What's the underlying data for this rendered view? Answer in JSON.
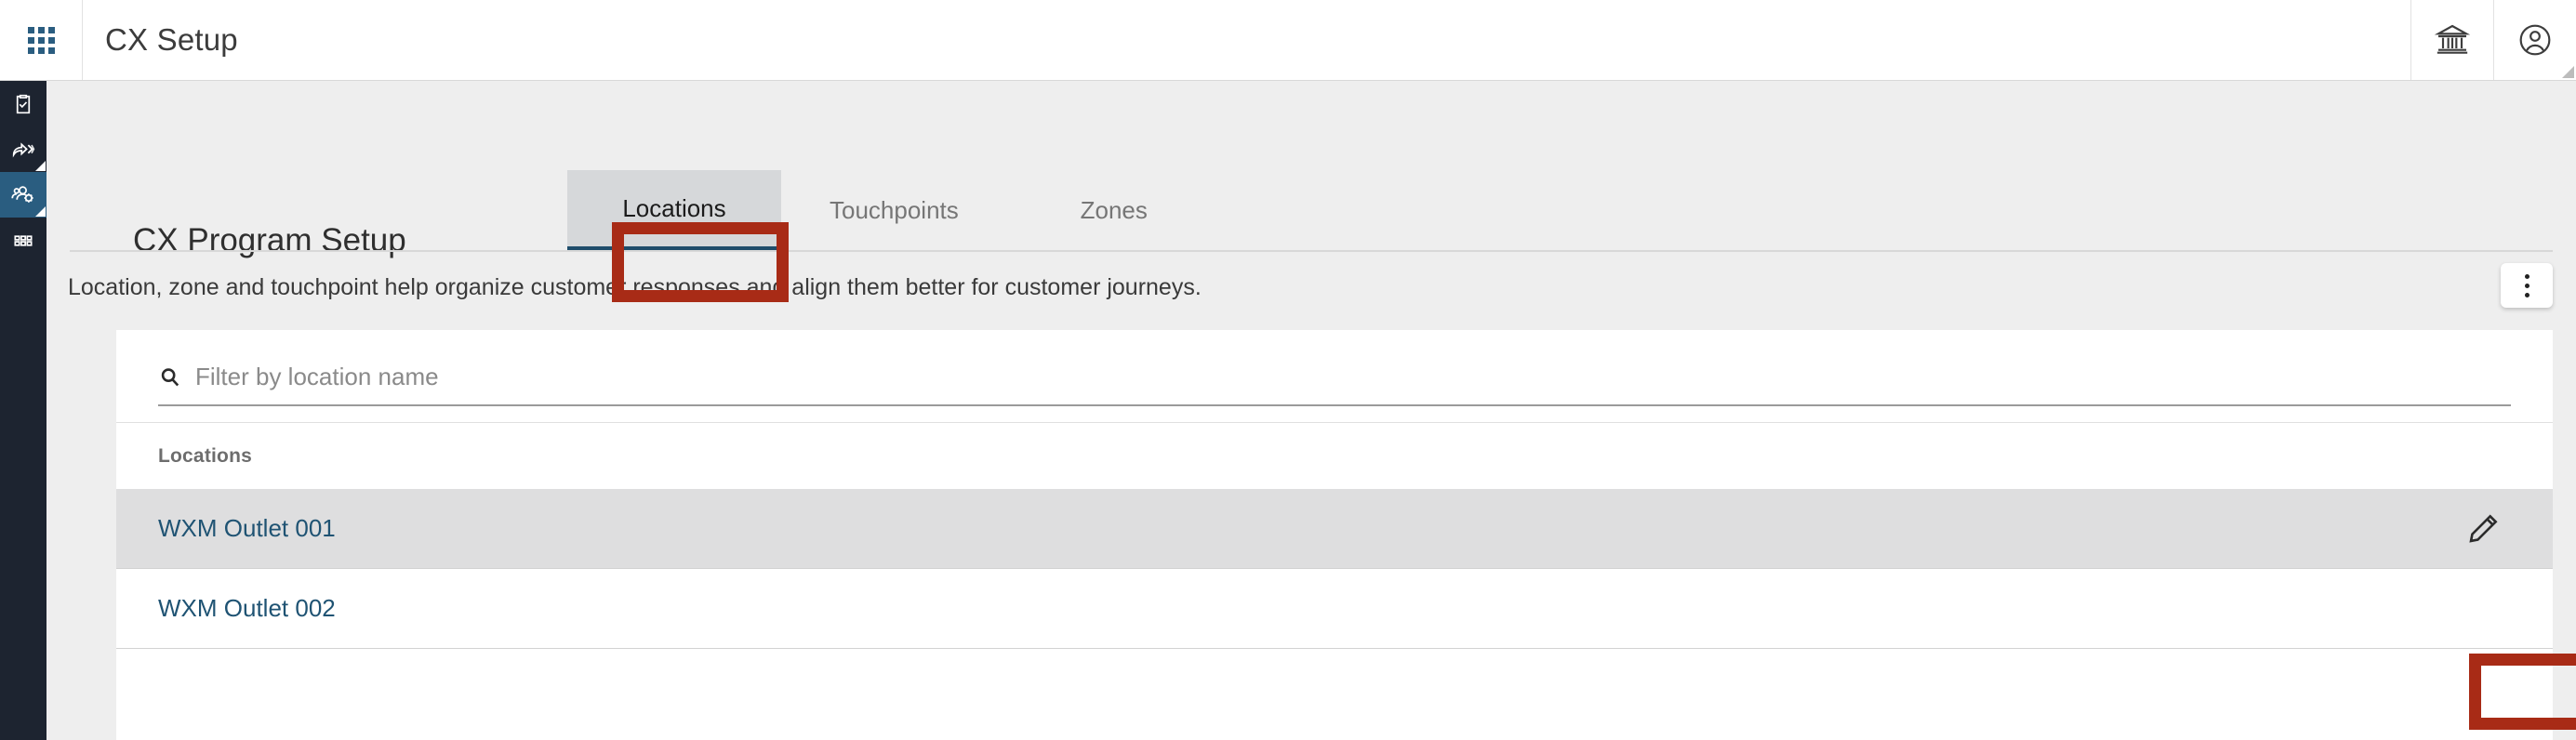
{
  "topbar": {
    "apps_icon": "apps-grid-icon",
    "title": "CX Setup",
    "actions": [
      {
        "icon": "bank-icon",
        "name": "institution-button"
      },
      {
        "icon": "user-circle-icon",
        "name": "account-button"
      }
    ]
  },
  "sidebar": {
    "items": [
      {
        "icon": "clipboard-check-icon",
        "name": "sidebar-item-surveys",
        "active": false,
        "corner": false
      },
      {
        "icon": "share-arrow-icon",
        "name": "sidebar-item-distribution",
        "active": false,
        "corner": true
      },
      {
        "icon": "people-gear-icon",
        "name": "sidebar-item-cx-setup",
        "active": true,
        "corner": true
      },
      {
        "icon": "modules-grid-icon",
        "name": "sidebar-item-modules",
        "active": false,
        "corner": false
      }
    ]
  },
  "page": {
    "title": "CX Program Setup",
    "description": "Location, zone and touchpoint help organize customer responses and align them better for customer journeys.",
    "overflow_menu_icon": "kebab-menu-icon"
  },
  "tabs": [
    {
      "label": "Locations",
      "active": true
    },
    {
      "label": "Touchpoints",
      "active": false
    },
    {
      "label": "Zones",
      "active": false
    }
  ],
  "search": {
    "icon": "search-icon",
    "placeholder": "Filter by location name",
    "value": ""
  },
  "table": {
    "column_header": "Locations",
    "rows": [
      {
        "name": "WXM Outlet 001",
        "hovered": true,
        "edit_icon": "pencil-edit-icon"
      },
      {
        "name": "WXM Outlet 002",
        "hovered": false,
        "edit_icon": "pencil-edit-icon"
      }
    ]
  },
  "annotations": [
    {
      "target": "locations-tab",
      "color": "#a82b16"
    },
    {
      "target": "edit-location-button",
      "color": "#a82b16"
    }
  ],
  "colors": {
    "sidebar_bg": "#1d2430",
    "sidebar_active": "#2a5d80",
    "page_bg": "#eeeeee",
    "card_bg": "#ffffff",
    "link": "#1f5373",
    "annotation": "#a82b16",
    "active_tab_bg": "#d6d8da",
    "row_hover_bg": "#dededf"
  }
}
